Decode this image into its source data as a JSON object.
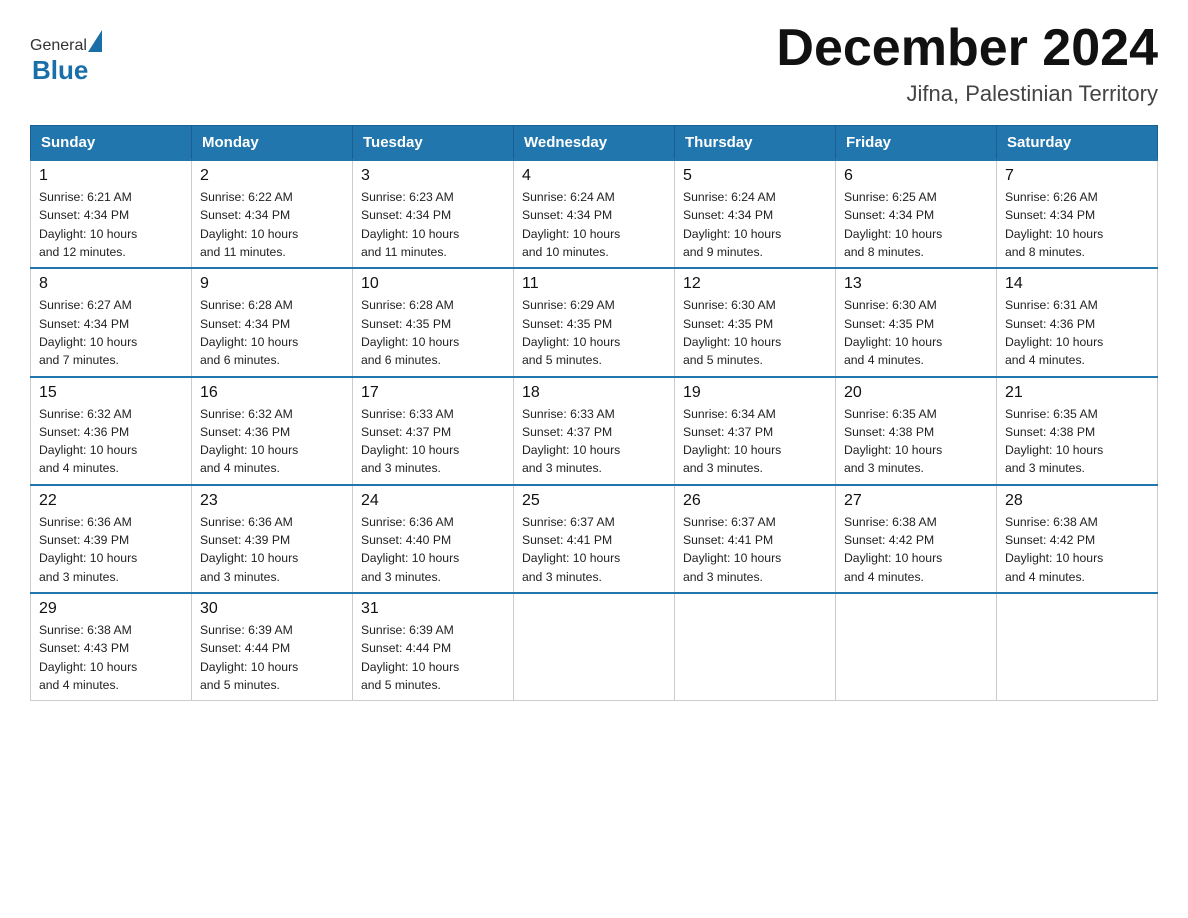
{
  "header": {
    "month_title": "December 2024",
    "location": "Jifna, Palestinian Territory"
  },
  "logo": {
    "line1_general": "General",
    "line2_blue": "Blue"
  },
  "weekdays": [
    "Sunday",
    "Monday",
    "Tuesday",
    "Wednesday",
    "Thursday",
    "Friday",
    "Saturday"
  ],
  "weeks": [
    [
      {
        "day": "1",
        "sunrise": "6:21 AM",
        "sunset": "4:34 PM",
        "daylight": "10 hours and 12 minutes."
      },
      {
        "day": "2",
        "sunrise": "6:22 AM",
        "sunset": "4:34 PM",
        "daylight": "10 hours and 11 minutes."
      },
      {
        "day": "3",
        "sunrise": "6:23 AM",
        "sunset": "4:34 PM",
        "daylight": "10 hours and 11 minutes."
      },
      {
        "day": "4",
        "sunrise": "6:24 AM",
        "sunset": "4:34 PM",
        "daylight": "10 hours and 10 minutes."
      },
      {
        "day": "5",
        "sunrise": "6:24 AM",
        "sunset": "4:34 PM",
        "daylight": "10 hours and 9 minutes."
      },
      {
        "day": "6",
        "sunrise": "6:25 AM",
        "sunset": "4:34 PM",
        "daylight": "10 hours and 8 minutes."
      },
      {
        "day": "7",
        "sunrise": "6:26 AM",
        "sunset": "4:34 PM",
        "daylight": "10 hours and 8 minutes."
      }
    ],
    [
      {
        "day": "8",
        "sunrise": "6:27 AM",
        "sunset": "4:34 PM",
        "daylight": "10 hours and 7 minutes."
      },
      {
        "day": "9",
        "sunrise": "6:28 AM",
        "sunset": "4:34 PM",
        "daylight": "10 hours and 6 minutes."
      },
      {
        "day": "10",
        "sunrise": "6:28 AM",
        "sunset": "4:35 PM",
        "daylight": "10 hours and 6 minutes."
      },
      {
        "day": "11",
        "sunrise": "6:29 AM",
        "sunset": "4:35 PM",
        "daylight": "10 hours and 5 minutes."
      },
      {
        "day": "12",
        "sunrise": "6:30 AM",
        "sunset": "4:35 PM",
        "daylight": "10 hours and 5 minutes."
      },
      {
        "day": "13",
        "sunrise": "6:30 AM",
        "sunset": "4:35 PM",
        "daylight": "10 hours and 4 minutes."
      },
      {
        "day": "14",
        "sunrise": "6:31 AM",
        "sunset": "4:36 PM",
        "daylight": "10 hours and 4 minutes."
      }
    ],
    [
      {
        "day": "15",
        "sunrise": "6:32 AM",
        "sunset": "4:36 PM",
        "daylight": "10 hours and 4 minutes."
      },
      {
        "day": "16",
        "sunrise": "6:32 AM",
        "sunset": "4:36 PM",
        "daylight": "10 hours and 4 minutes."
      },
      {
        "day": "17",
        "sunrise": "6:33 AM",
        "sunset": "4:37 PM",
        "daylight": "10 hours and 3 minutes."
      },
      {
        "day": "18",
        "sunrise": "6:33 AM",
        "sunset": "4:37 PM",
        "daylight": "10 hours and 3 minutes."
      },
      {
        "day": "19",
        "sunrise": "6:34 AM",
        "sunset": "4:37 PM",
        "daylight": "10 hours and 3 minutes."
      },
      {
        "day": "20",
        "sunrise": "6:35 AM",
        "sunset": "4:38 PM",
        "daylight": "10 hours and 3 minutes."
      },
      {
        "day": "21",
        "sunrise": "6:35 AM",
        "sunset": "4:38 PM",
        "daylight": "10 hours and 3 minutes."
      }
    ],
    [
      {
        "day": "22",
        "sunrise": "6:36 AM",
        "sunset": "4:39 PM",
        "daylight": "10 hours and 3 minutes."
      },
      {
        "day": "23",
        "sunrise": "6:36 AM",
        "sunset": "4:39 PM",
        "daylight": "10 hours and 3 minutes."
      },
      {
        "day": "24",
        "sunrise": "6:36 AM",
        "sunset": "4:40 PM",
        "daylight": "10 hours and 3 minutes."
      },
      {
        "day": "25",
        "sunrise": "6:37 AM",
        "sunset": "4:41 PM",
        "daylight": "10 hours and 3 minutes."
      },
      {
        "day": "26",
        "sunrise": "6:37 AM",
        "sunset": "4:41 PM",
        "daylight": "10 hours and 3 minutes."
      },
      {
        "day": "27",
        "sunrise": "6:38 AM",
        "sunset": "4:42 PM",
        "daylight": "10 hours and 4 minutes."
      },
      {
        "day": "28",
        "sunrise": "6:38 AM",
        "sunset": "4:42 PM",
        "daylight": "10 hours and 4 minutes."
      }
    ],
    [
      {
        "day": "29",
        "sunrise": "6:38 AM",
        "sunset": "4:43 PM",
        "daylight": "10 hours and 4 minutes."
      },
      {
        "day": "30",
        "sunrise": "6:39 AM",
        "sunset": "4:44 PM",
        "daylight": "10 hours and 5 minutes."
      },
      {
        "day": "31",
        "sunrise": "6:39 AM",
        "sunset": "4:44 PM",
        "daylight": "10 hours and 5 minutes."
      },
      null,
      null,
      null,
      null
    ]
  ],
  "labels": {
    "sunrise": "Sunrise:",
    "sunset": "Sunset:",
    "daylight": "Daylight:"
  }
}
